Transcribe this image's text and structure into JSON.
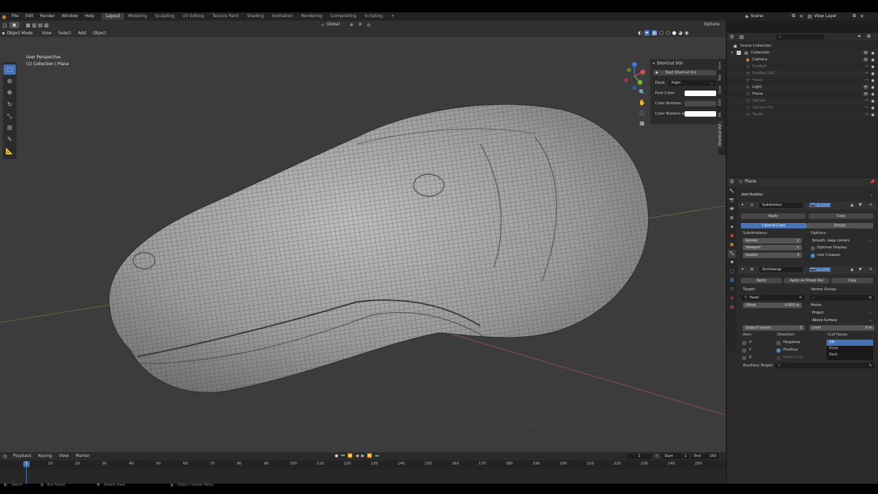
{
  "topbar": {
    "menus": [
      "File",
      "Edit",
      "Render",
      "Window",
      "Help"
    ],
    "workspaces": [
      "Layout",
      "Modeling",
      "Sculpting",
      "UV Editing",
      "Texture Paint",
      "Shading",
      "Animation",
      "Rendering",
      "Compositing",
      "Scripting"
    ],
    "active_workspace": "Layout",
    "add_tab": "+",
    "scene_label": "Scene",
    "viewlayer_label": "View Layer"
  },
  "viewport": {
    "mode": "Object Mode",
    "menus": [
      "View",
      "Select",
      "Add",
      "Object"
    ],
    "orientation": "Global",
    "options": "Options",
    "info_line1": "User Perspective",
    "info_line2": "(1) Collection | Plane",
    "gizmo_axes": {
      "x": "X",
      "y": "Y",
      "z": "Z"
    },
    "colors": {
      "x": "#e04a5a",
      "y": "#7ab33b",
      "z": "#3f7fe0",
      "bg": "#3c3c3c",
      "mesh": "#9a9a9a"
    }
  },
  "npanel": {
    "title": "Shortcut VUr",
    "start_button": "Start Shortcut VUr",
    "dock_label": "Dock:",
    "dock_value": "Right",
    "font_color_label": "Font Color:",
    "color_buttons_label": "Color Buttons:",
    "color_buttons_a_label": "Color Buttons a",
    "tabs": [
      "Item",
      "Tool",
      "View",
      "Edit",
      "AN",
      "Shortcut VUr"
    ]
  },
  "timeline": {
    "menus": [
      "Playback",
      "Keying",
      "View",
      "Marker"
    ],
    "current_frame": "1",
    "start_label": "Start",
    "start_value": "1",
    "end_label": "End",
    "end_value": "250",
    "ticks": [
      "1",
      "10",
      "20",
      "30",
      "40",
      "50",
      "60",
      "70",
      "80",
      "90",
      "100",
      "110",
      "120",
      "130",
      "140",
      "150",
      "160",
      "170",
      "180",
      "190",
      "200",
      "210",
      "220",
      "230",
      "240",
      "250"
    ]
  },
  "statusbar": {
    "select": "Select",
    "box_select": "Box Select",
    "rotate_view": "Rotate View",
    "context_menu": "Object Context Menu"
  },
  "outliner": {
    "root": "Scene Collection",
    "collection": "Collection",
    "items": [
      {
        "name": "Camera",
        "dim": false,
        "color": "#d08a3c"
      },
      {
        "name": "EyeBall",
        "dim": true,
        "color": "#d08a3c"
      },
      {
        "name": "EyeBall.001",
        "dim": true,
        "color": "#d08a3c"
      },
      {
        "name": "Head",
        "dim": true,
        "color": "#d08a3c"
      },
      {
        "name": "Light",
        "dim": false,
        "color": "#d08a3c"
      },
      {
        "name": "Plane",
        "dim": false,
        "color": "#d08a3c"
      },
      {
        "name": "Sphere",
        "dim": true,
        "color": "#d08a3c"
      },
      {
        "name": "Sphere.001",
        "dim": true,
        "color": "#d08a3c"
      },
      {
        "name": "Teeth",
        "dim": true,
        "color": "#d08a3c"
      }
    ]
  },
  "properties": {
    "object_name": "Plane",
    "add_modifier": "Add Modifier",
    "subdivision": {
      "name": "Subdivision",
      "apply": "Apply",
      "copy": "Copy",
      "catmull": "Catmull-Clark",
      "simple": "Simple",
      "subdivisions_label": "Subdivisions:",
      "render_label": "Render",
      "render_value": "2",
      "viewport_label": "Viewport",
      "viewport_value": "1",
      "quality_label": "Quality",
      "quality_value": "3",
      "options_label": "Options:",
      "uv_smooth": "Smooth, keep corners",
      "optimal_display": "Optimal Display",
      "use_creases": "Use Creases"
    },
    "shrinkwrap": {
      "name": "Shrinkwrap",
      "apply": "Apply",
      "apply_shape": "Apply as Shape Key",
      "copy": "Copy",
      "target_label": "Target:",
      "target_value": "Head",
      "vertex_group_label": "Vertex Group:",
      "offset_label": "Offset",
      "offset_value": "0.003 m",
      "mode_label": "Mode:",
      "mode_value": "Project",
      "snap_mode": "Above Surface",
      "subsurf_label": "Subsurf Levels",
      "subsurf_value": "0",
      "limit_label": "Limit",
      "limit_value": "0 m",
      "axis_label": "Axis:",
      "axes": [
        "X",
        "Y",
        "Z"
      ],
      "direction_label": "Direction:",
      "negative": "Negative",
      "positive": "Positive",
      "invert_cull": "Invert Cull",
      "cull_faces_label": "Cull Faces:",
      "cull_options": [
        "Off",
        "Front",
        "Back"
      ],
      "aux_label": "Auxiliary Target:"
    }
  }
}
